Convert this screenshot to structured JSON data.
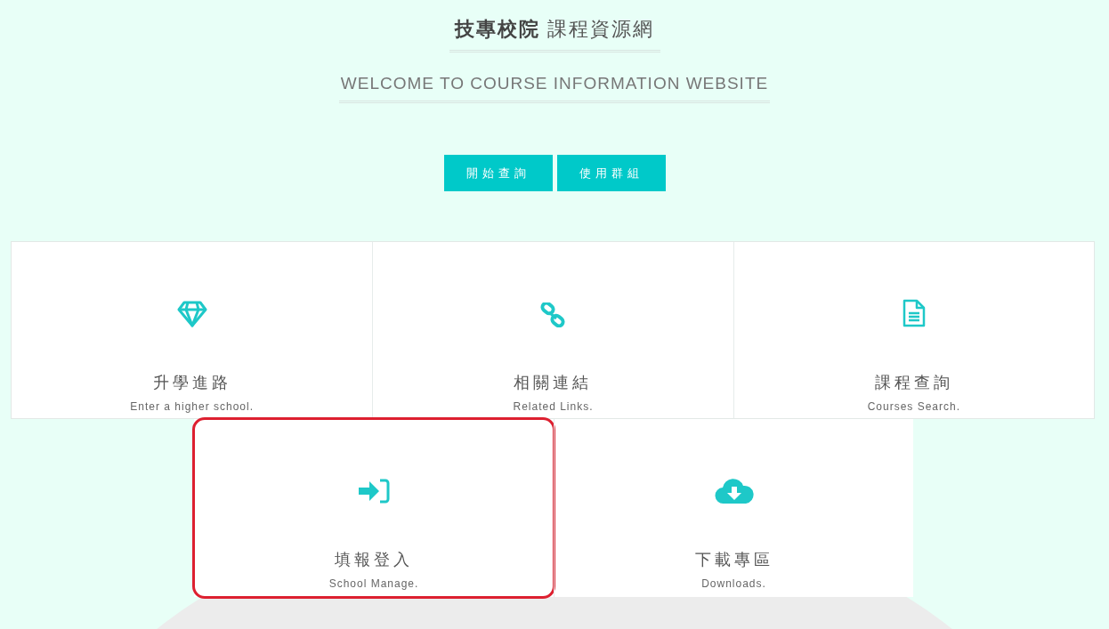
{
  "header": {
    "title": "**技專校院** 課程資源網",
    "subtitle": "WELCOME TO COURSE INFORMATION WEBSITE"
  },
  "buttons": [
    "開始查詢",
    "使用群組"
  ],
  "tiles": [
    {
      "title": "升學進路",
      "caption": "Enter a higher school.",
      "highlighted": false
    },
    {
      "title": "相關連結",
      "caption": "Related Links.",
      "highlighted": false
    },
    {
      "title": "課程查詢",
      "caption": "Courses Search.",
      "highlighted": false
    },
    {
      "title": "填報登入",
      "caption": "School Manage.",
      "highlighted": true
    },
    {
      "title": "下載專區",
      "caption": "Downloads.",
      "highlighted": false
    }
  ]
}
